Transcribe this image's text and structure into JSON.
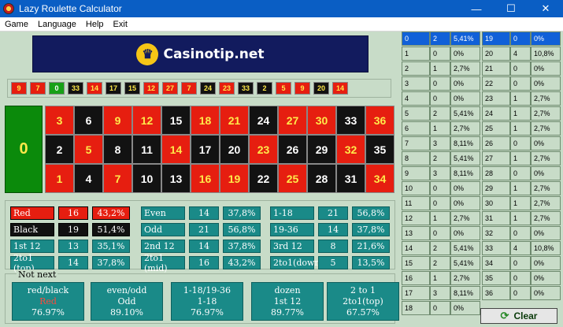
{
  "window": {
    "title": "Lazy Roulette Calculator",
    "minimize": "—",
    "maximize": "☐",
    "close": "✕"
  },
  "menu": [
    "Game",
    "Language",
    "Help",
    "Exit"
  ],
  "banner": {
    "logo": "Casinotip.net",
    "icon": "trophy-icon"
  },
  "history": [
    {
      "n": "9",
      "c": "red"
    },
    {
      "n": "7",
      "c": "red"
    },
    {
      "n": "0",
      "c": "green"
    },
    {
      "n": "33",
      "c": "black"
    },
    {
      "n": "14",
      "c": "red"
    },
    {
      "n": "17",
      "c": "black"
    },
    {
      "n": "15",
      "c": "black"
    },
    {
      "n": "12",
      "c": "red"
    },
    {
      "n": "27",
      "c": "red"
    },
    {
      "n": "7",
      "c": "red"
    },
    {
      "n": "24",
      "c": "black"
    },
    {
      "n": "23",
      "c": "red"
    },
    {
      "n": "33",
      "c": "black"
    },
    {
      "n": "2",
      "c": "black"
    },
    {
      "n": "5",
      "c": "red"
    },
    {
      "n": "9",
      "c": "red"
    },
    {
      "n": "20",
      "c": "black"
    },
    {
      "n": "14",
      "c": "red"
    }
  ],
  "board": {
    "zero": "0",
    "rows": [
      [
        {
          "n": "3",
          "c": "red"
        },
        {
          "n": "6",
          "c": "black"
        },
        {
          "n": "9",
          "c": "red"
        },
        {
          "n": "12",
          "c": "red"
        },
        {
          "n": "15",
          "c": "black"
        },
        {
          "n": "18",
          "c": "red"
        },
        {
          "n": "21",
          "c": "red"
        },
        {
          "n": "24",
          "c": "black"
        },
        {
          "n": "27",
          "c": "red"
        },
        {
          "n": "30",
          "c": "red"
        },
        {
          "n": "33",
          "c": "black"
        },
        {
          "n": "36",
          "c": "red"
        }
      ],
      [
        {
          "n": "2",
          "c": "black"
        },
        {
          "n": "5",
          "c": "red"
        },
        {
          "n": "8",
          "c": "black"
        },
        {
          "n": "11",
          "c": "black"
        },
        {
          "n": "14",
          "c": "red"
        },
        {
          "n": "17",
          "c": "black"
        },
        {
          "n": "20",
          "c": "black"
        },
        {
          "n": "23",
          "c": "red"
        },
        {
          "n": "26",
          "c": "black"
        },
        {
          "n": "29",
          "c": "black"
        },
        {
          "n": "32",
          "c": "red"
        },
        {
          "n": "35",
          "c": "black"
        }
      ],
      [
        {
          "n": "1",
          "c": "red"
        },
        {
          "n": "4",
          "c": "black"
        },
        {
          "n": "7",
          "c": "red"
        },
        {
          "n": "10",
          "c": "black"
        },
        {
          "n": "13",
          "c": "black"
        },
        {
          "n": "16",
          "c": "red"
        },
        {
          "n": "19",
          "c": "red"
        },
        {
          "n": "22",
          "c": "black"
        },
        {
          "n": "25",
          "c": "red"
        },
        {
          "n": "28",
          "c": "black"
        },
        {
          "n": "31",
          "c": "black"
        },
        {
          "n": "34",
          "c": "red"
        }
      ]
    ]
  },
  "stats": [
    [
      {
        "l": "Red",
        "n": "16",
        "p": "43,2%",
        "style": "red"
      },
      {
        "l": "Even",
        "n": "14",
        "p": "37,8%"
      },
      {
        "l": "1-18",
        "n": "21",
        "p": "56,8%"
      }
    ],
    [
      {
        "l": "Black",
        "n": "19",
        "p": "51,4%",
        "style": "black"
      },
      {
        "l": "Odd",
        "n": "21",
        "p": "56,8%"
      },
      {
        "l": "19-36",
        "n": "14",
        "p": "37,8%"
      }
    ],
    [
      {
        "l": "1st 12",
        "n": "13",
        "p": "35,1%"
      },
      {
        "l": "2nd 12",
        "n": "14",
        "p": "37,8%"
      },
      {
        "l": "3rd 12",
        "n": "8",
        "p": "21,6%"
      }
    ],
    [
      {
        "l": "2to1 (top)",
        "n": "14",
        "p": "37,8%"
      },
      {
        "l": "2to1 (mid)",
        "n": "16",
        "p": "43,2%"
      },
      {
        "l": "2to1(down)",
        "n": "5",
        "p": "13,5%"
      }
    ]
  ],
  "not_next": {
    "label": "Not next",
    "boxes": [
      {
        "title": "red/black",
        "value": "Red",
        "pct": "76.97%",
        "red": true
      },
      {
        "title": "even/odd",
        "value": "Odd",
        "pct": "89.10%"
      },
      {
        "title": "1-18/19-36",
        "value": "1-18",
        "pct": "76.97%"
      },
      {
        "title": "dozen",
        "value": "1st 12",
        "pct": "89.77%"
      },
      {
        "title": "2 to 1",
        "value": "2to1(top)",
        "pct": "67.57%"
      }
    ]
  },
  "freq_left": [
    [
      "0",
      "2",
      "5,41%"
    ],
    [
      "1",
      "0",
      "0%"
    ],
    [
      "2",
      "1",
      "2,7%"
    ],
    [
      "3",
      "0",
      "0%"
    ],
    [
      "4",
      "0",
      "0%"
    ],
    [
      "5",
      "2",
      "5,41%"
    ],
    [
      "6",
      "1",
      "2,7%"
    ],
    [
      "7",
      "3",
      "8,11%"
    ],
    [
      "8",
      "2",
      "5,41%"
    ],
    [
      "9",
      "3",
      "8,11%"
    ],
    [
      "10",
      "0",
      "0%"
    ],
    [
      "11",
      "0",
      "0%"
    ],
    [
      "12",
      "1",
      "2,7%"
    ],
    [
      "13",
      "0",
      "0%"
    ],
    [
      "14",
      "2",
      "5,41%"
    ],
    [
      "15",
      "2",
      "5,41%"
    ],
    [
      "16",
      "1",
      "2,7%"
    ],
    [
      "17",
      "3",
      "8,11%"
    ],
    [
      "18",
      "0",
      "0%"
    ]
  ],
  "freq_right": [
    [
      "19",
      "0",
      "0%"
    ],
    [
      "20",
      "4",
      "10,8%"
    ],
    [
      "21",
      "0",
      "0%"
    ],
    [
      "22",
      "0",
      "0%"
    ],
    [
      "23",
      "1",
      "2,7%"
    ],
    [
      "24",
      "1",
      "2,7%"
    ],
    [
      "25",
      "1",
      "2,7%"
    ],
    [
      "26",
      "0",
      "0%"
    ],
    [
      "27",
      "1",
      "2,7%"
    ],
    [
      "28",
      "0",
      "0%"
    ],
    [
      "29",
      "1",
      "2,7%"
    ],
    [
      "30",
      "1",
      "2,7%"
    ],
    [
      "31",
      "1",
      "2,7%"
    ],
    [
      "32",
      "0",
      "0%"
    ],
    [
      "33",
      "4",
      "10,8%"
    ],
    [
      "34",
      "0",
      "0%"
    ],
    [
      "35",
      "0",
      "0%"
    ],
    [
      "36",
      "0",
      "0%"
    ]
  ],
  "clear_button": "Clear",
  "colors": {
    "red": "#e61e10",
    "black": "#121212",
    "green": "#0b8a0b",
    "teal": "#1a8a88",
    "highlight": "#1060d8"
  }
}
